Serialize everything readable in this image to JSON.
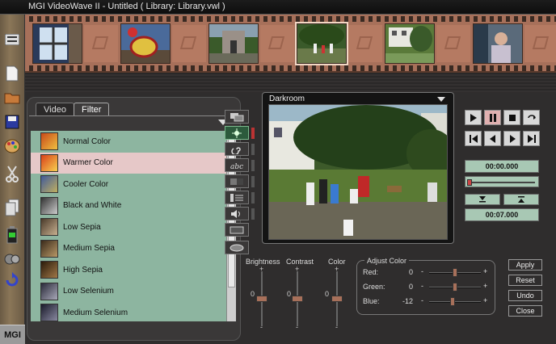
{
  "window": {
    "title": "MGI VideoWave II - Untitled ( Library: Library.vwl )"
  },
  "sidebar": {
    "logo": "MGI",
    "icons": [
      "menu-icon",
      "new-document-icon",
      "folder-icon",
      "save-disk-icon",
      "palette-icon",
      "scissors-icon",
      "copy-pages-icon",
      "battery-icon",
      "film-reel-icon",
      "undo-arrow-icon"
    ]
  },
  "storyline": {
    "frames": [
      "room-window",
      "tray-food",
      "stone-church",
      "park-family",
      "house-garden",
      "woman-portrait"
    ],
    "selected_index": 3
  },
  "tabs": [
    {
      "label": "Video",
      "active": false
    },
    {
      "label": "Filter",
      "active": true
    }
  ],
  "filters": [
    {
      "label": "Normal Color",
      "selected": false
    },
    {
      "label": "Warmer Color",
      "selected": true
    },
    {
      "label": "Cooler Color",
      "selected": false
    },
    {
      "label": "Black and White",
      "selected": false
    },
    {
      "label": "Low Sepia",
      "selected": false
    },
    {
      "label": "Medium Sepia",
      "selected": false
    },
    {
      "label": "High Sepia",
      "selected": false
    },
    {
      "label": "Low Selenium",
      "selected": false
    },
    {
      "label": "Medium Selenium",
      "selected": false
    }
  ],
  "effects": [
    "layers-icon",
    "sparkle-filter-icon",
    "swirl-icon",
    "text-abc-icon",
    "transition-icon",
    "list-icon",
    "audio-icon",
    "film-icon",
    "export-icon"
  ],
  "darkroom": {
    "title": "Darkroom"
  },
  "transport": {
    "start_time": "00:00.000",
    "end_time": "00:07.000"
  },
  "sliders": {
    "brightness": {
      "label": "Brightness",
      "value": "0"
    },
    "contrast": {
      "label": "Contrast",
      "value": "0"
    },
    "color": {
      "label": "Color",
      "value": "0"
    }
  },
  "adjust_color": {
    "title": "Adjust Color",
    "red": {
      "label": "Red:",
      "value": "0"
    },
    "green": {
      "label": "Green:",
      "value": "0"
    },
    "blue": {
      "label": "Blue:",
      "value": "-12"
    }
  },
  "buttons": {
    "apply": "Apply",
    "reset": "Reset",
    "undo": "Undo",
    "close": "Close"
  },
  "symbols": {
    "plus": "+",
    "minus": "-",
    "zero": "0"
  },
  "colors": {
    "filmstrip": "#a7705a",
    "list_bg": "#8db5a0",
    "selected_row": "#e6c8c8"
  }
}
